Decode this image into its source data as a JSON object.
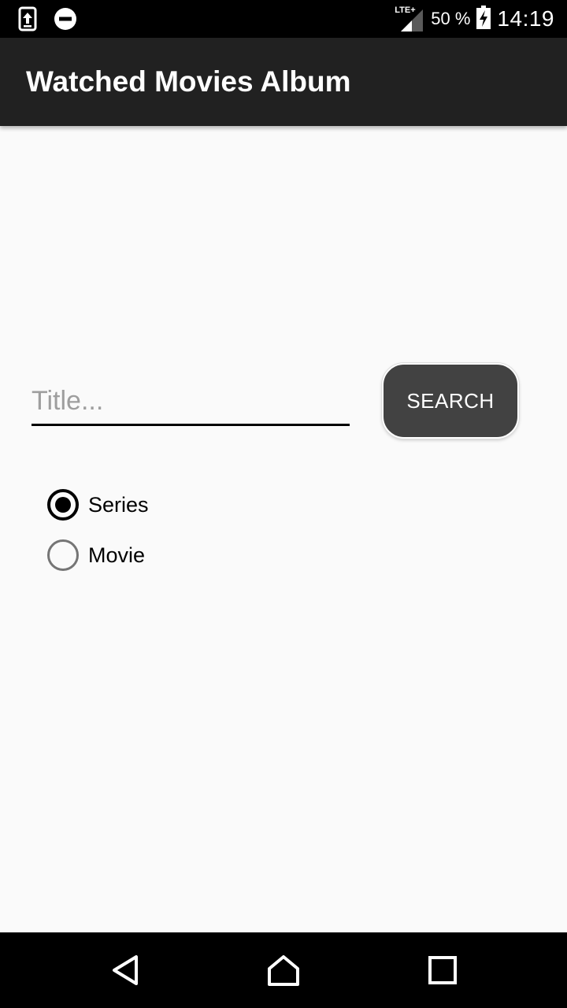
{
  "status_bar": {
    "network_label": "LTE+",
    "battery_percent": "50 %",
    "time": "14:19",
    "icons": [
      "screenshot-upload-icon",
      "do-not-disturb-icon",
      "signal-icon",
      "battery-charging-icon"
    ]
  },
  "app_bar": {
    "title": "Watched Movies Album",
    "color": "#212121"
  },
  "search": {
    "placeholder": "Title...",
    "value": "",
    "button_label": "SEARCH",
    "button_color": "#424242"
  },
  "type_options": [
    {
      "label": "Series",
      "selected": true
    },
    {
      "label": "Movie",
      "selected": false
    }
  ],
  "nav_bar": {
    "icons": [
      "back-icon",
      "home-icon",
      "recents-icon"
    ]
  }
}
